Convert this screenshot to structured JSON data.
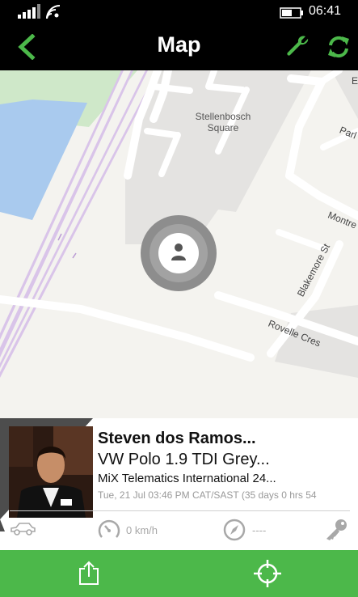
{
  "status_bar": {
    "time": "06:41"
  },
  "header": {
    "title": "Map"
  },
  "map": {
    "labels": {
      "place": "Stellenbosch Square"
    },
    "streets": {
      "blakemore": "Blakemore St",
      "rovelle": "Rovelle Cres",
      "montre": "Montre",
      "parl": "Parl",
      "edge_e": "E"
    }
  },
  "driver": {
    "name": "Steven dos Ramos...",
    "vehicle": "VW Polo 1.9 TDI Grey...",
    "organisation": "MiX Telematics International 24...",
    "last_update": "Tue, 21 Jul 03:46 PM CAT/SAST (35 days 0 hrs 54",
    "speed": "0 km/h",
    "heading": "----"
  },
  "colors": {
    "accent": "#4cb84a",
    "header_bg": "#000000",
    "water": "#a9caee",
    "park": "#cfe8c9",
    "highway": "#d9c4e9"
  },
  "icons": [
    "signal-icon",
    "wifi-icon",
    "battery-icon",
    "back-arrow-icon",
    "wrench-icon",
    "refresh-icon",
    "person-icon",
    "car-icon",
    "speedometer-icon",
    "compass-icon",
    "key-icon",
    "share-icon",
    "locate-icon"
  ]
}
